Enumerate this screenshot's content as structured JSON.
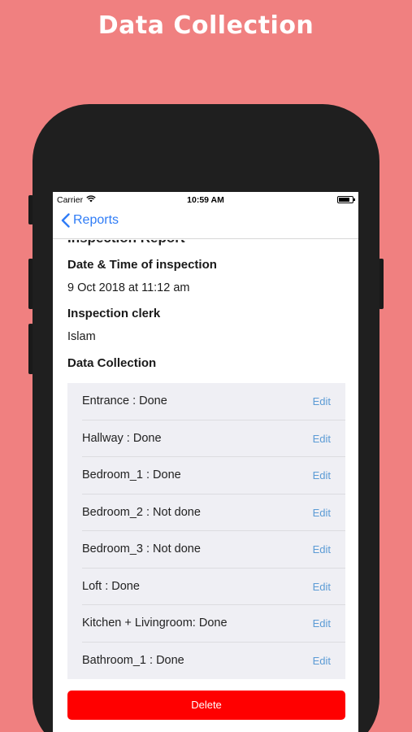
{
  "headline": "Data Collection",
  "status_bar": {
    "carrier": "Carrier",
    "time": "10:59 AM"
  },
  "nav": {
    "back_label": "Reports"
  },
  "report": {
    "title": "Inspection Report",
    "datetime_label": "Date & Time of inspection",
    "datetime_value": "9 Oct 2018 at 11:12 am",
    "clerk_label": "Inspection clerk",
    "clerk_value": "Islam",
    "section_label": "Data Collection"
  },
  "rows": [
    {
      "text": "Entrance : Done",
      "action": "Edit"
    },
    {
      "text": "Hallway : Done",
      "action": "Edit"
    },
    {
      "text": "Bedroom_1 : Done",
      "action": "Edit"
    },
    {
      "text": "Bedroom_2 : Not done",
      "action": "Edit"
    },
    {
      "text": "Bedroom_3 : Not done",
      "action": "Edit"
    },
    {
      "text": "Loft : Done",
      "action": "Edit"
    },
    {
      "text": "Kitchen + Livingroom: Done",
      "action": "Edit"
    },
    {
      "text": "Bathroom_1 : Done",
      "action": "Edit"
    }
  ],
  "delete_label": "Delete",
  "colors": {
    "background": "#f08080",
    "accent": "#2f7cf6",
    "delete": "#ff0000"
  }
}
